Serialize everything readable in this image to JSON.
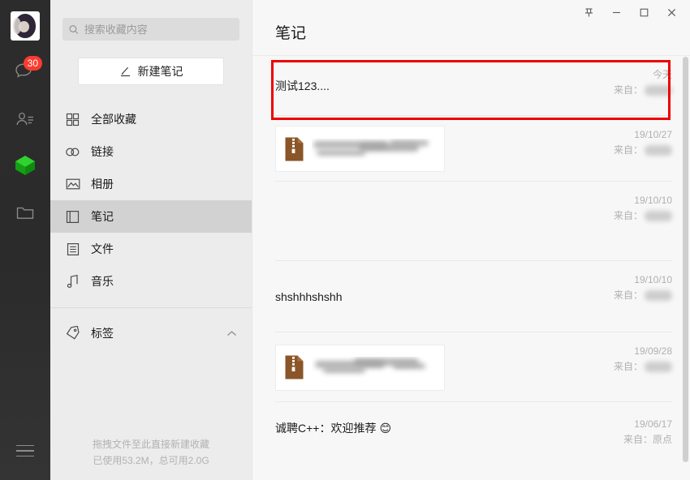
{
  "rail": {
    "avatar_name": "user-avatar",
    "chat_badge": "30",
    "icons": [
      "chat-icon",
      "contacts-icon",
      "favorites-cube-icon",
      "files-icon",
      "menu-icon"
    ]
  },
  "sidebar": {
    "search": {
      "placeholder": "搜索收藏内容",
      "value": ""
    },
    "new_note_label": "新建笔记",
    "items": [
      {
        "label": "全部收藏",
        "icon": "grid-icon",
        "active": false
      },
      {
        "label": "链接",
        "icon": "link-icon",
        "active": false
      },
      {
        "label": "相册",
        "icon": "image-icon",
        "active": false
      },
      {
        "label": "笔记",
        "icon": "note-icon",
        "active": true
      },
      {
        "label": "文件",
        "icon": "file-icon",
        "active": false
      },
      {
        "label": "音乐",
        "icon": "music-icon",
        "active": false
      }
    ],
    "tag_section": {
      "label": "标签",
      "icon": "tag-icon",
      "chevron": "chevron-up-icon"
    },
    "footer": {
      "line1": "拖拽文件至此直接新建收藏",
      "line2": "已使用53.2M，总可用2.0G"
    }
  },
  "titlebar": {
    "pin": "pin-icon",
    "minimize": "minimize-icon",
    "maximize": "maximize-icon",
    "close": "close-icon"
  },
  "main": {
    "title": "笔记",
    "from_label": "来自：",
    "rows": [
      {
        "type": "text",
        "title": "测试123....",
        "date": "今天",
        "from": "来自：",
        "highlighted": true
      },
      {
        "type": "file",
        "title": "",
        "date": "19/10/27",
        "from": "来自：",
        "highlighted": false
      },
      {
        "type": "empty",
        "title": "",
        "date": "19/10/10",
        "from": "来自：",
        "highlighted": false
      },
      {
        "type": "text",
        "title": "shshhhshshh",
        "date": "19/10/10",
        "from": "来自：",
        "highlighted": false
      },
      {
        "type": "file",
        "title": "",
        "date": "19/09/28",
        "from": "来自：",
        "highlighted": false
      },
      {
        "type": "text",
        "title": "诚聘C++：欢迎推荐",
        "emoji": "😊",
        "date": "19/06/17",
        "from": "来自：原点",
        "highlighted": false
      }
    ]
  },
  "colors": {
    "rail_bg": "#2c2c2c",
    "sidebar_bg": "#ececec",
    "main_bg": "#f7f7f7",
    "badge_red": "#fa3c30",
    "annotation_red": "#ee0000",
    "cube_green": "#22bb22",
    "zip_brown": "#8a5528"
  }
}
